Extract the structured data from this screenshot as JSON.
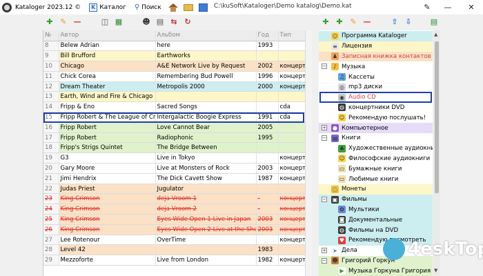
{
  "window": {
    "app_title": "Kataloger 2023.12 ©",
    "path": "C:\\kuSoft\\Kataloger\\Demo katalog\\Demo.kat",
    "menu": {
      "catalog_letter": "K",
      "catalog": "Каталог",
      "search": "Поиск"
    }
  },
  "colors": {
    "accent": "#1c3fa8",
    "delete_red": "#e03030",
    "add_green": "#2ea02e",
    "peach": "#fbe1c5",
    "yellow": "#fdf6c8",
    "green": "#dff2cc",
    "cyan": "#cdeef0"
  },
  "grid": {
    "columns": [
      "№",
      "Автор",
      "Альбом",
      "Год",
      "Тип"
    ],
    "rows": [
      {
        "n": "8",
        "author": "Belew Adrian",
        "album": "here",
        "year": "1993",
        "type": "",
        "style": "white"
      },
      {
        "n": "9",
        "author": "Bill Brufford",
        "album": "Earthworks",
        "year": "",
        "type": "",
        "style": "yellow"
      },
      {
        "n": "10",
        "author": "Chicago",
        "album": "A&E Network Live by Request",
        "year": "2002",
        "type": "концертник",
        "style": "peach"
      },
      {
        "n": "11",
        "author": "Chick Corea",
        "album": "Remembering Bud Powell",
        "year": "1996",
        "type": "концертник",
        "style": "white"
      },
      {
        "n": "12",
        "author": "Dream Theater",
        "album": "Metropolis 2000",
        "year": "2000",
        "type": "концертник",
        "style": "cyan"
      },
      {
        "n": "13",
        "author": "Earth, Wind and Fire  &  Chicago",
        "album": "",
        "year": "",
        "type": "",
        "style": "yellow"
      },
      {
        "n": "14",
        "author": "Fripp & Eno",
        "album": "Sacred Songs",
        "year": "",
        "type": "cda",
        "style": "white"
      },
      {
        "n": "15",
        "author": "Fripp Robert & The League of Cra",
        "album": "Intergalactic Boogie Express",
        "year": "1991",
        "type": "cda",
        "style": "selected"
      },
      {
        "n": "16",
        "author": "Fripp Robert",
        "album": "Love Cannot Bear",
        "year": "2005",
        "type": "",
        "style": "green"
      },
      {
        "n": "17",
        "author": "Fripp Robert",
        "album": "Radiophonic",
        "year": "1995",
        "type": "",
        "style": "green"
      },
      {
        "n": "18",
        "author": "Fripp's Strigs Quintet",
        "album": "The Bridge Between",
        "year": "",
        "type": "",
        "style": "green"
      },
      {
        "n": "19",
        "author": "G3",
        "album": "Live in Tokyo",
        "year": "",
        "type": "концертник",
        "style": "white"
      },
      {
        "n": "20",
        "author": "Gary Moore",
        "album": "Live at Monsters of Rock",
        "year": "2003",
        "type": "концертник",
        "style": "white"
      },
      {
        "n": "21",
        "author": "Jimi Hendrix",
        "album": "The Dick Cavett Show",
        "year": "1987",
        "type": "концертник",
        "style": "white"
      },
      {
        "n": "22",
        "author": "Judas Priest",
        "album": "Jugulator",
        "year": "",
        "type": "",
        "style": "peach"
      },
      {
        "n": "23",
        "author": "King Crimson",
        "album": "deja Vroom 1",
        "year": "-",
        "type": "концертник",
        "style": "strike"
      },
      {
        "n": "24",
        "author": "King Crimson",
        "album": "deja Vroom 2",
        "year": "-",
        "type": "концертник",
        "style": "strike"
      },
      {
        "n": "25",
        "author": "King Crimson",
        "album": "Eyes Wide Open 1 Live in Japan",
        "year": "2003",
        "type": "концертник",
        "style": "strike"
      },
      {
        "n": "26",
        "author": "King Crimson",
        "album": "Eyes Wide Open 2 Live at the Shepl",
        "year": "2003",
        "type": "концертник",
        "style": "strike"
      },
      {
        "n": "27",
        "author": "Lee Rotenour",
        "album": "OverTime",
        "year": "",
        "type": "концертник",
        "style": "white"
      },
      {
        "n": "28",
        "author": "Level 42",
        "album": "",
        "year": "1983",
        "type": "",
        "style": "peach"
      },
      {
        "n": "29",
        "author": "Mezzoforte",
        "album": "Live from London",
        "year": "1982",
        "type": "концертник",
        "style": "white"
      }
    ]
  },
  "tree": {
    "nodes": [
      {
        "label": "Программа Kataloger",
        "icon": "smiley-icon",
        "bg": "#cdeef0",
        "color": "#000",
        "indent": 0,
        "expander": ""
      },
      {
        "label": "Лицензия",
        "icon": "document-icon",
        "bg": "#fdf6c8",
        "color": "#000",
        "indent": 0,
        "expander": ""
      },
      {
        "label": "Записная книжка контактов",
        "icon": "contacts-icon",
        "bg": "#fbe1c5",
        "color": "#d04040",
        "indent": 0,
        "expander": ""
      },
      {
        "label": "Музыка",
        "icon": "music-icon",
        "bg": "#ffffff",
        "color": "#000",
        "indent": 0,
        "expander": "−"
      },
      {
        "label": "Кассеты",
        "icon": "cassette-icon",
        "bg": "#ffffff",
        "color": "#000",
        "indent": 1,
        "expander": ""
      },
      {
        "label": "mp3 диски",
        "icon": "disc-icon",
        "bg": "#ffffff",
        "color": "#000",
        "indent": 1,
        "expander": ""
      },
      {
        "label": "Audio CD",
        "icon": "cd-icon",
        "bg": "#ffffff",
        "color": "#d04040",
        "indent": 1,
        "expander": ""
      },
      {
        "label": "концертники DVD",
        "icon": "dvd-icon",
        "bg": "#ffffff",
        "color": "#000",
        "indent": 1,
        "expander": ""
      },
      {
        "label": "Рекомендую послушать!",
        "icon": "smiley-icon",
        "bg": "#ffffff",
        "color": "#000",
        "indent": 1,
        "expander": ""
      },
      {
        "label": "Компьютерное",
        "icon": "dot-icon",
        "bg": "#e6dcf7",
        "color": "#000",
        "indent": 0,
        "expander": "+"
      },
      {
        "label": "Книги",
        "icon": "books-icon",
        "bg": "#ffffff",
        "color": "#000",
        "indent": 0,
        "expander": "−"
      },
      {
        "label": "Художественные аудиокниги",
        "icon": "tree-icon",
        "bg": "#ffffff",
        "color": "#000",
        "indent": 1,
        "expander": ""
      },
      {
        "label": "Философские аудиокниги",
        "icon": "smiley-icon",
        "bg": "#ffffff",
        "color": "#000",
        "indent": 1,
        "expander": ""
      },
      {
        "label": "Бумажные книги",
        "icon": "book-icon",
        "bg": "#ffffff",
        "color": "#000",
        "indent": 1,
        "expander": ""
      },
      {
        "label": "Любимые книги",
        "icon": "book-icon",
        "bg": "#ffffff",
        "color": "#000",
        "indent": 1,
        "expander": ""
      },
      {
        "label": "Монеты",
        "icon": "coin-icon",
        "bg": "#fdf6c8",
        "color": "#000",
        "indent": 0,
        "expander": ""
      },
      {
        "label": "Фильмы",
        "icon": "film-icon",
        "bg": "#cdeef0",
        "color": "#000",
        "indent": 0,
        "expander": "−"
      },
      {
        "label": "Мультики",
        "icon": "cartoon-icon",
        "bg": "#cdeef0",
        "color": "#000",
        "indent": 1,
        "expander": ""
      },
      {
        "label": "Документальные",
        "icon": "camera-icon",
        "bg": "#cdeef0",
        "color": "#000",
        "indent": 1,
        "expander": ""
      },
      {
        "label": "Фильмы на DVD",
        "icon": "dvd-icon",
        "bg": "#cdeef0",
        "color": "#000",
        "indent": 1,
        "expander": ""
      },
      {
        "label": "Рекомендую посмотреть",
        "icon": "heart-icon",
        "bg": "#cdeef0",
        "color": "#000",
        "indent": 1,
        "expander": ""
      },
      {
        "label": "Дела",
        "icon": "arrow-icon",
        "bg": "#ffffff",
        "color": "#000",
        "indent": 0,
        "expander": "+"
      },
      {
        "label": "Григорий Горкун",
        "icon": "person-icon",
        "bg": "#dff2cc",
        "color": "#000",
        "indent": 0,
        "expander": "−"
      },
      {
        "label": "Музыка Горкуна Григория",
        "icon": "play-icon",
        "bg": "#dff2cc",
        "color": "#000",
        "indent": 1,
        "expander": ""
      }
    ]
  },
  "watermark": {
    "text": "4eskTop"
  }
}
